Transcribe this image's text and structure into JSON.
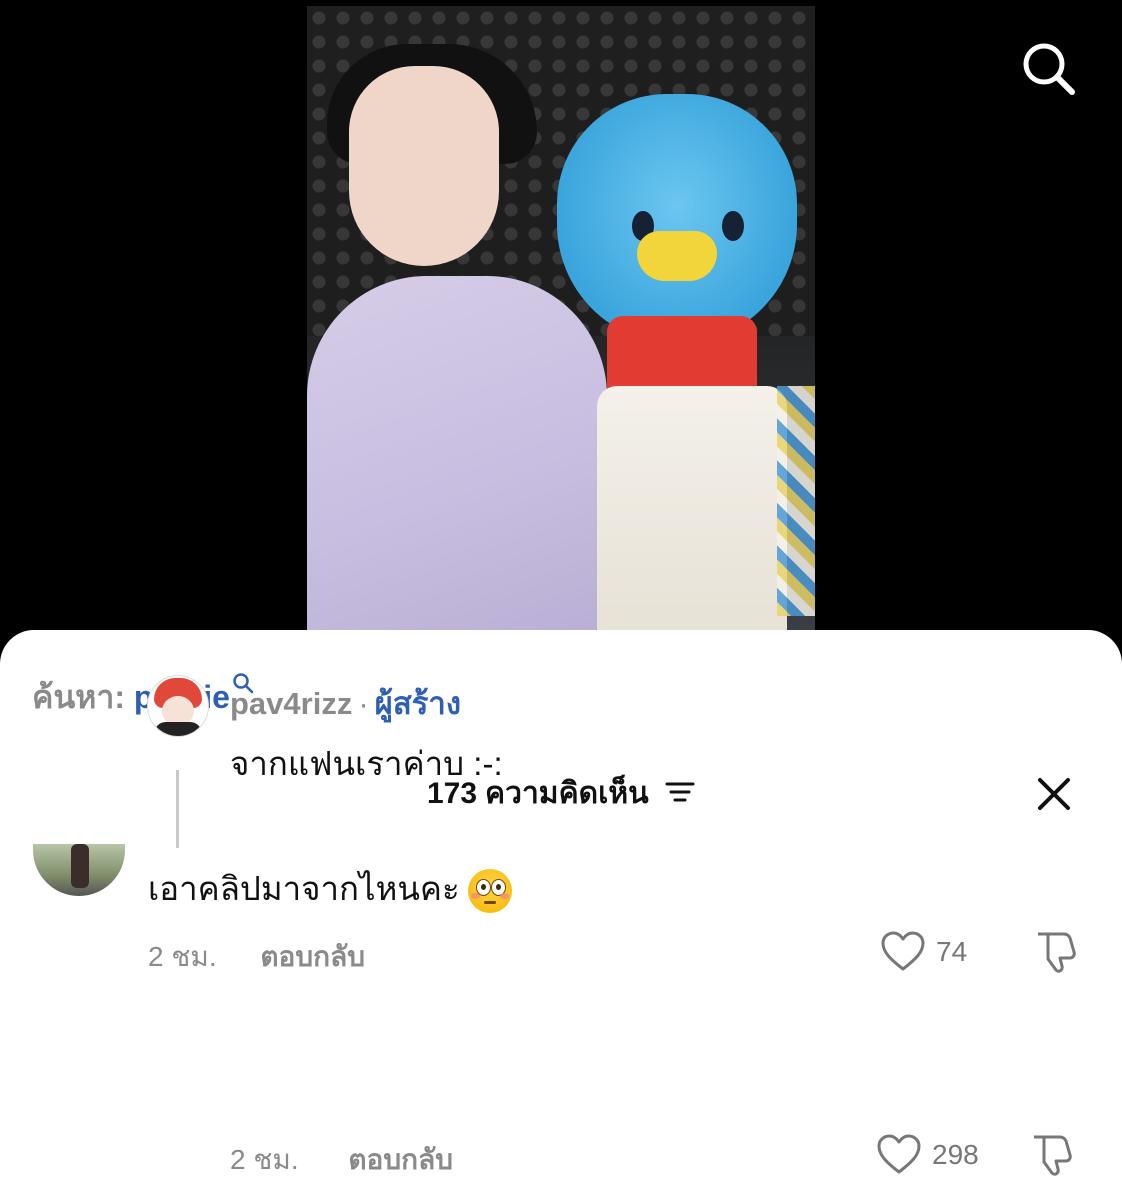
{
  "search": {
    "prefix": "ค้นหา:",
    "term": "proxie"
  },
  "comments": {
    "count": "173",
    "title": "ความคิดเห็น"
  },
  "comment1": {
    "text": "เอาคลิปมาจากไหนคะ",
    "time": "2 ชม.",
    "reply": "ตอบกลับ",
    "likes": "74"
  },
  "reply1": {
    "username": "pav4rizz",
    "separator": "·",
    "badge": "ผู้สร้าง",
    "text": "จากแฟนเราค่าบ :-:",
    "time": "2 ชม.",
    "reply": "ตอบกลับ",
    "likes": "298"
  },
  "icons": {
    "search": "search-icon",
    "filter": "filter-icon",
    "close": "close-icon",
    "like": "heart-icon",
    "dislike": "thumbs-down-icon"
  },
  "colors": {
    "link_blue": "#2f5fb3",
    "muted": "#8a8a8a"
  }
}
